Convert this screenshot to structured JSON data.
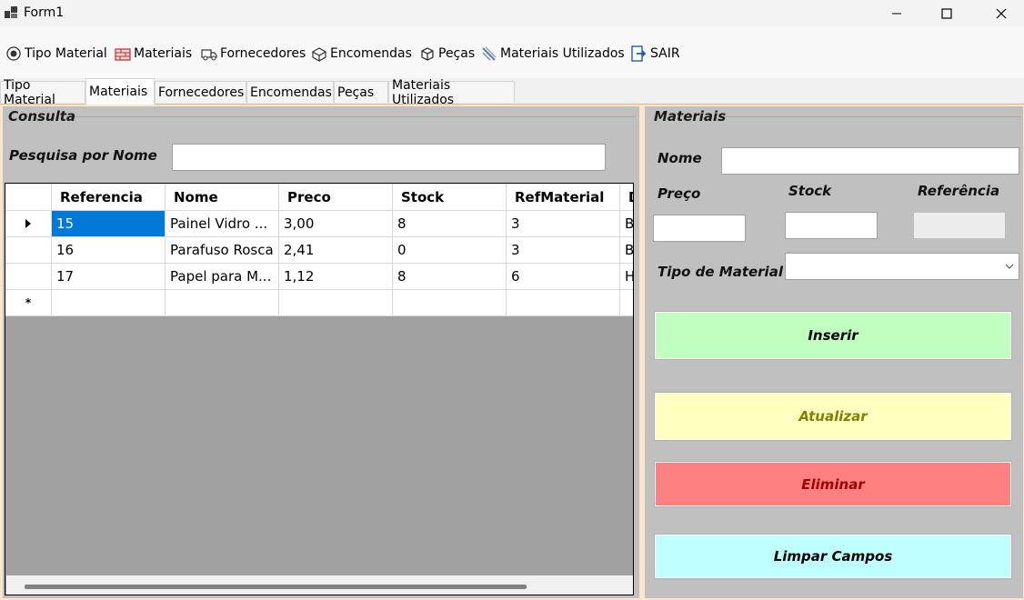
{
  "window": {
    "title": "Form1"
  },
  "menu": [
    {
      "label": "Tipo Material",
      "icon": "radio-icon"
    },
    {
      "label": "Materiais",
      "icon": "bricks-icon"
    },
    {
      "label": "Fornecedores",
      "icon": "truck-icon"
    },
    {
      "label": "Encomendas",
      "icon": "boxes-icon"
    },
    {
      "label": "Peças",
      "icon": "cube-icon"
    },
    {
      "label": "Materiais Utilizados",
      "icon": "tools-icon"
    },
    {
      "label": "SAIR",
      "icon": "exit-icon"
    }
  ],
  "tabs": [
    "Tipo Material",
    "Materiais",
    "Fornecedores",
    "Encomendas",
    "Peças",
    "Materiais Utilizados"
  ],
  "active_tab": "Materiais",
  "consulta": {
    "title": "Consulta",
    "search_label": "Pesquisa por Nome",
    "search_value": ""
  },
  "grid": {
    "columns": [
      "Referencia",
      "Nome",
      "Preco",
      "Stock",
      "RefMaterial",
      "D"
    ],
    "rows": [
      [
        "15",
        "Painel Vidro ...",
        "3,00",
        "8",
        "3",
        "B"
      ],
      [
        "16",
        "Parafuso Rosca",
        "2,41",
        "0",
        "3",
        "B"
      ],
      [
        "17",
        "Papel para M...",
        "1,12",
        "8",
        "6",
        "H"
      ]
    ],
    "new_row_marker": "*",
    "current_row_marker": "▸"
  },
  "materiais": {
    "title": "Materiais",
    "nome_label": "Nome",
    "preco_label": "Preço",
    "stock_label": "Stock",
    "referencia_label": "Referência",
    "tipo_label": "Tipo de Material",
    "nome_value": "",
    "preco_value": "",
    "stock_value": "",
    "referencia_value": "",
    "tipo_value": ""
  },
  "buttons": {
    "inserir": "Inserir",
    "atualizar": "Atualizar",
    "eliminar": "Eliminar",
    "limpar": "Limpar Campos"
  },
  "colors": {
    "inserir_bg": "#c0ffc0",
    "atualizar_bg": "#ffffc0",
    "atualizar_text": "#808000",
    "eliminar_bg": "#ff8080",
    "eliminar_text": "#a00000",
    "limpar_bg": "#c0ffff",
    "selection": "#0078d7",
    "panel": "#c0c0c0",
    "tab_page": "#fbe5cd"
  }
}
